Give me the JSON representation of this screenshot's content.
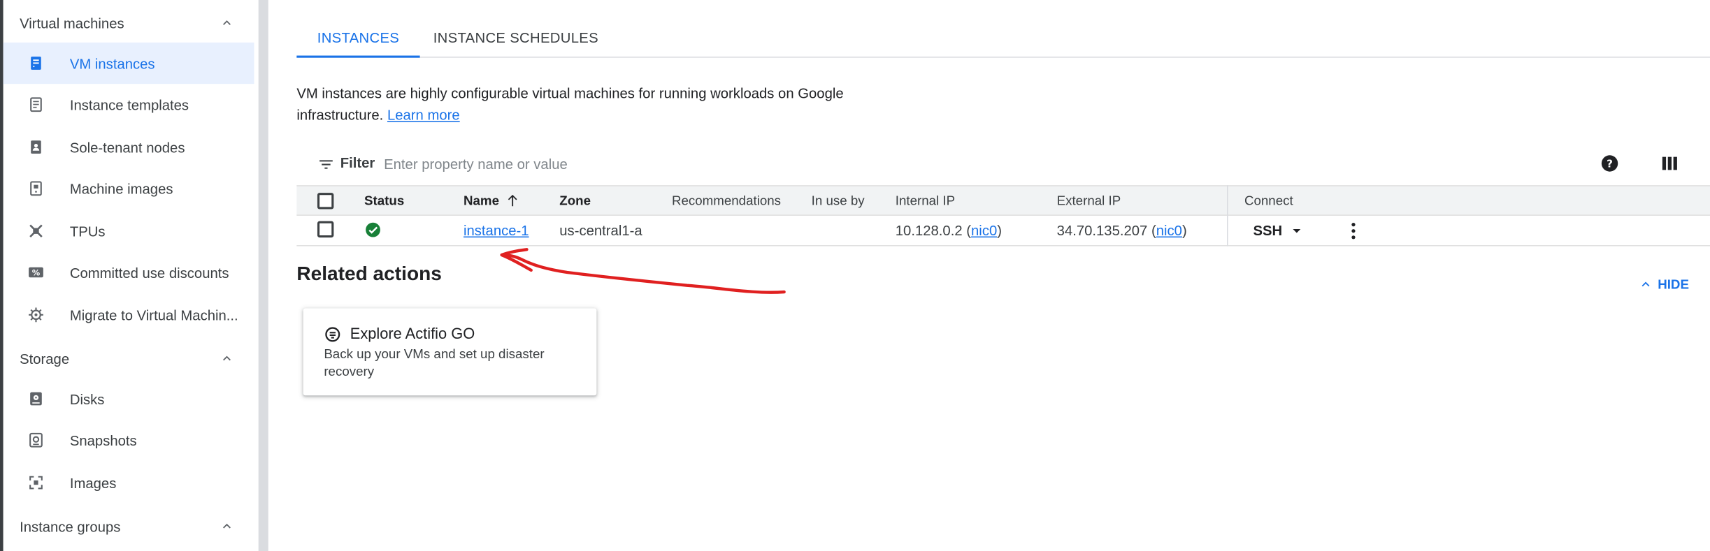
{
  "sidebar": {
    "sections": [
      {
        "label": "Virtual machines"
      },
      {
        "label": "Storage"
      },
      {
        "label": "Instance groups"
      }
    ],
    "vm_items": [
      {
        "label": "VM instances",
        "icon": "vm-instance-icon"
      },
      {
        "label": "Instance templates",
        "icon": "template-icon"
      },
      {
        "label": "Sole-tenant nodes",
        "icon": "sole-tenant-icon"
      },
      {
        "label": "Machine images",
        "icon": "machine-image-icon"
      },
      {
        "label": "TPUs",
        "icon": "tpu-icon"
      },
      {
        "label": "Committed use discounts",
        "icon": "percent-icon"
      },
      {
        "label": "Migrate to Virtual Machin...",
        "icon": "migrate-icon"
      }
    ],
    "storage_items": [
      {
        "label": "Disks",
        "icon": "disk-icon"
      },
      {
        "label": "Snapshots",
        "icon": "snapshot-icon"
      },
      {
        "label": "Images",
        "icon": "image-icon"
      }
    ]
  },
  "tabs": [
    {
      "label": "INSTANCES",
      "active": true
    },
    {
      "label": "INSTANCE SCHEDULES",
      "active": false
    }
  ],
  "description": {
    "text": "VM instances are highly configurable virtual machines for running workloads on Google infrastructure.",
    "link": "Learn more"
  },
  "filter": {
    "label": "Filter",
    "placeholder": "Enter property name or value"
  },
  "table": {
    "headers": {
      "status": "Status",
      "name": "Name",
      "zone": "Zone",
      "recommendations": "Recommendations",
      "in_use_by": "In use by",
      "internal_ip": "Internal IP",
      "external_ip": "External IP",
      "connect": "Connect"
    },
    "rows": [
      {
        "status": "running",
        "name": "instance-1",
        "zone": "us-central1-a",
        "recommendations": "",
        "in_use_by": "",
        "internal_ip": "10.128.0.2",
        "internal_nic": "nic0",
        "external_ip": "34.70.135.207",
        "external_nic": "nic0",
        "connect": "SSH"
      }
    ]
  },
  "related": {
    "title": "Related actions",
    "hide_label": "HIDE",
    "card": {
      "title": "Explore Actifio GO",
      "description": "Back up your VMs and set up disaster recovery"
    }
  },
  "colors": {
    "accent": "#1a73e8",
    "status_ok": "#188038",
    "annotation": "#e02020"
  }
}
